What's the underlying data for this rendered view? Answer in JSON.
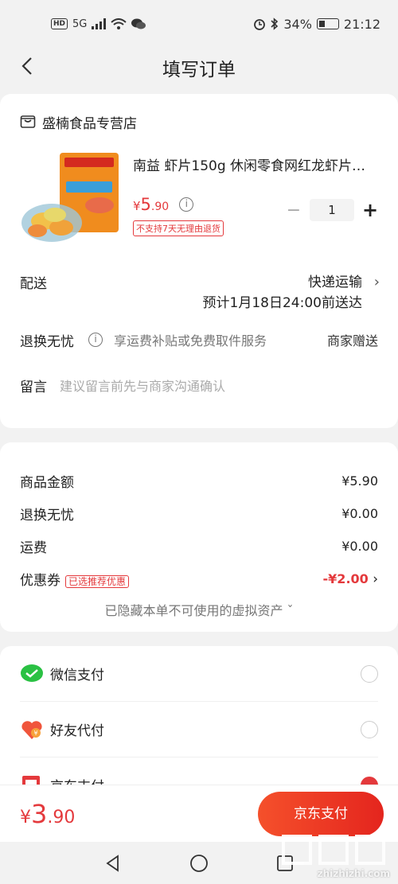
{
  "status_bar": {
    "network": "5G",
    "battery": "34%",
    "battery_level": 0.34,
    "time": "21:12"
  },
  "header": {
    "title": "填写订单"
  },
  "store": {
    "name": "盛楠食品专营店"
  },
  "product": {
    "title": "南益 虾片150g 休闲零食网红龙虾片…",
    "price_currency": "¥",
    "price_int": "5",
    "price_dec": ".90",
    "quantity": "1",
    "tag": "不支持7天无理由退货"
  },
  "shipping": {
    "label": "配送",
    "method": "快递运输",
    "eta": "预计1月18日24:00前送达"
  },
  "returns": {
    "label": "退换无忧",
    "desc": "享运费补贴或免费取件服务",
    "merchant": "商家赠送"
  },
  "message": {
    "label": "留言",
    "placeholder": "建议留言前先与商家沟通确认"
  },
  "summary": {
    "rows": [
      {
        "label": "商品金额",
        "value": "¥5.90"
      },
      {
        "label": "退换无忧",
        "value": "¥0.00"
      },
      {
        "label": "运费",
        "value": "¥0.00"
      }
    ],
    "coupon": {
      "label": "优惠券",
      "tag": "已选推荐优惠",
      "value": "-¥2.00"
    },
    "hidden_note": "已隐藏本单不可使用的虚拟资产"
  },
  "payment": {
    "methods": [
      {
        "label": "微信支付",
        "selected": false
      },
      {
        "label": "好友代付",
        "selected": false
      },
      {
        "label": "京东支付",
        "selected": true
      }
    ]
  },
  "footer": {
    "currency": "¥",
    "total_int": "3",
    "total_dec": ".90",
    "pay_button": "京东支付"
  },
  "watermark": {
    "text": "zhizhizhi.com"
  },
  "colors": {
    "accent": "#e4393c",
    "wechat": "#2ac143"
  }
}
